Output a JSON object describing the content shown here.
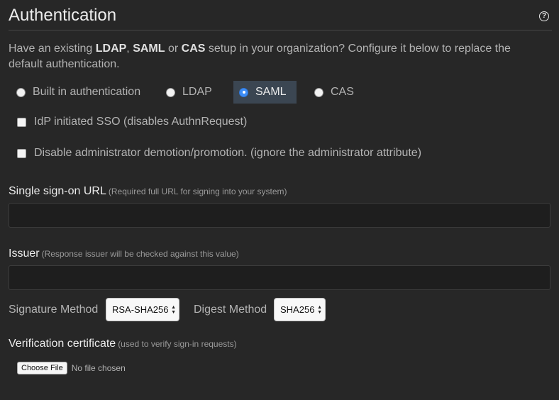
{
  "header": {
    "title": "Authentication",
    "help_icon": "question-circle-icon"
  },
  "intro": {
    "prefix": "Have an existing ",
    "ldap": "LDAP",
    "sep1": ", ",
    "saml": "SAML",
    "sep2": " or ",
    "cas": "CAS",
    "suffix": " setup in your organization? Configure it below to replace the default authentication."
  },
  "auth_options": [
    {
      "label": "Built in authentication",
      "selected": false
    },
    {
      "label": "LDAP",
      "selected": false
    },
    {
      "label": "SAML",
      "selected": true
    },
    {
      "label": "CAS",
      "selected": false
    }
  ],
  "checkboxes": {
    "idp_sso": {
      "label": "IdP initiated SSO (disables AuthnRequest)",
      "checked": false
    },
    "disable_demotion": {
      "label": "Disable administrator demotion/promotion. (ignore the administrator attribute)",
      "checked": false
    }
  },
  "sso_url": {
    "label": "Single sign-on URL",
    "hint": "(Required full URL for signing into your system)",
    "value": ""
  },
  "issuer": {
    "label": "Issuer",
    "hint": "(Response issuer will be checked against this value)",
    "value": ""
  },
  "signature_method": {
    "label": "Signature Method",
    "value": "RSA-SHA256"
  },
  "digest_method": {
    "label": "Digest Method",
    "value": "SHA256"
  },
  "certificate": {
    "label": "Verification certificate",
    "hint": "(used to verify sign-in requests)",
    "button": "Choose File",
    "status": "No file chosen"
  },
  "colors": {
    "background": "#272727",
    "selected_option_bg": "#3b4652",
    "radio_accent": "#3d8df5"
  }
}
